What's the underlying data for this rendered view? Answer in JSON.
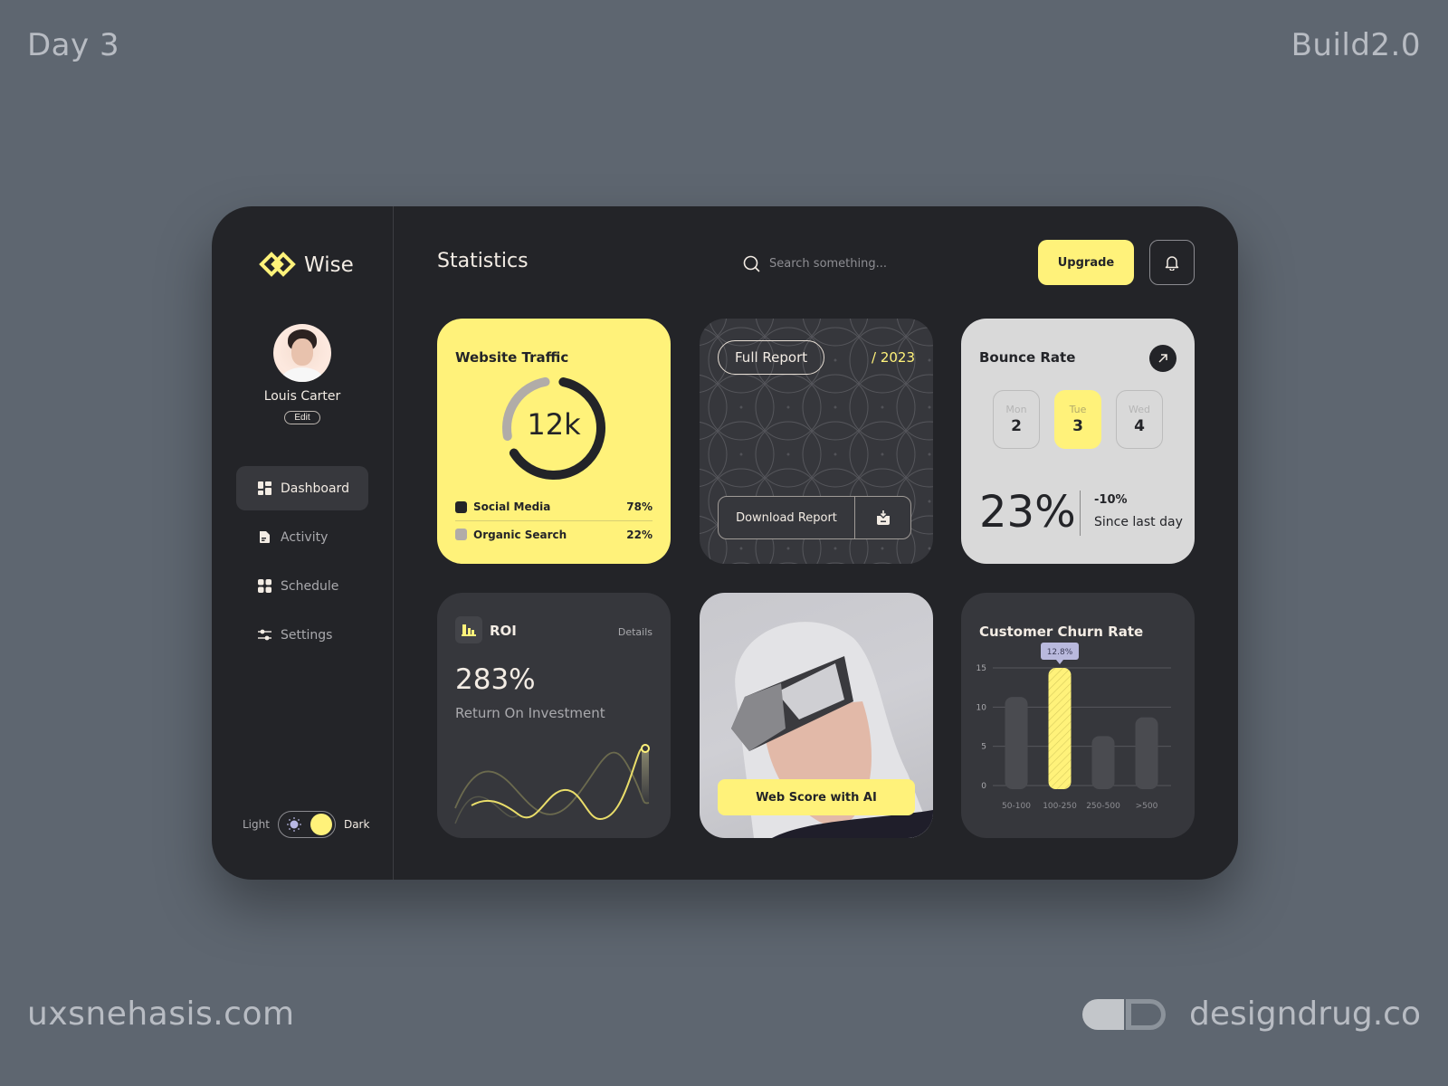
{
  "frame": {
    "top_left": "Day 3",
    "top_right": "Build2.0",
    "bottom_left": "uxsnehasis.com",
    "bottom_right": "designdrug.co"
  },
  "sidebar": {
    "logo_text": "Wise",
    "profile": {
      "name": "Louis Carter",
      "edit_label": "Edit"
    },
    "nav": [
      {
        "label": "Dashboard",
        "icon": "dashboard-icon",
        "active": true
      },
      {
        "label": "Activity",
        "icon": "document-icon",
        "active": false
      },
      {
        "label": "Schedule",
        "icon": "grid-icon",
        "active": false
      },
      {
        "label": "Settings",
        "icon": "sliders-icon",
        "active": false
      }
    ],
    "theme": {
      "light_label": "Light",
      "dark_label": "Dark",
      "selected": "Dark"
    }
  },
  "header": {
    "title": "Statistics",
    "search_placeholder": "Search something...",
    "upgrade_label": "Upgrade"
  },
  "colors": {
    "accent": "#fff27a",
    "panel": "#232428",
    "card_dark": "#36373c",
    "card_light": "#d9d9d9",
    "tooltip": "#b9b9dd"
  },
  "website_traffic": {
    "title": "Website Traffic",
    "total": "12k",
    "legend": [
      {
        "label": "Social Media",
        "value": "78%",
        "percent": 78,
        "color": "#232428"
      },
      {
        "label": "Organic Search",
        "value": "22%",
        "percent": 22,
        "color": "#b1aca8"
      }
    ]
  },
  "report": {
    "full_report_label": "Full Report",
    "year": "/ 2023",
    "download_label": "Download Report"
  },
  "bounce_rate": {
    "title": "Bounce Rate",
    "days": [
      {
        "name": "Mon",
        "num": "2",
        "active": false
      },
      {
        "name": "Tue",
        "num": "3",
        "active": true
      },
      {
        "name": "Wed",
        "num": "4",
        "active": false
      }
    ],
    "value": "23%",
    "delta": "-10%",
    "delta_caption": "Since last day"
  },
  "roi": {
    "title": "ROI",
    "details_label": "Details",
    "value": "283%",
    "caption": "Return On Investment"
  },
  "web_score": {
    "button_label": "Web Score with AI"
  },
  "chart_data": {
    "type": "bar",
    "title": "Customer Churn Rate",
    "categories": [
      "50-100",
      "100-250",
      "250-500",
      ">500"
    ],
    "values": [
      11.3,
      15,
      6.3,
      8.7
    ],
    "highlight_index": 1,
    "highlight_label": "12.8%",
    "yticks": [
      0,
      5,
      10,
      15
    ],
    "ylim": [
      0,
      15
    ],
    "grid": true,
    "xlabel": "",
    "ylabel": ""
  }
}
